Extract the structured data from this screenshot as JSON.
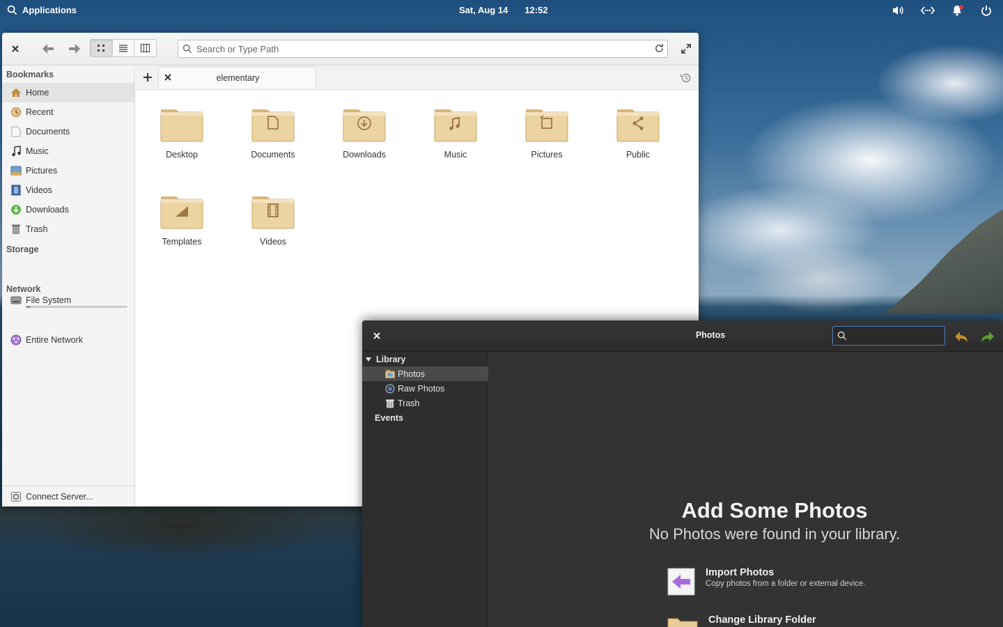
{
  "panel": {
    "applications_label": "Applications",
    "date": "Sat, Aug 14",
    "time": "12:52"
  },
  "files": {
    "path_placeholder": "Search or Type Path",
    "tab_label": "elementary",
    "sidebar": {
      "bookmarks_heading": "Bookmarks",
      "bookmarks": [
        {
          "label": "Home",
          "icon": "home-icon"
        },
        {
          "label": "Recent",
          "icon": "recent-icon"
        },
        {
          "label": "Documents",
          "icon": "document-icon"
        },
        {
          "label": "Music",
          "icon": "music-icon"
        },
        {
          "label": "Pictures",
          "icon": "pictures-icon"
        },
        {
          "label": "Videos",
          "icon": "videos-icon"
        },
        {
          "label": "Downloads",
          "icon": "downloads-icon"
        },
        {
          "label": "Trash",
          "icon": "trash-icon"
        }
      ],
      "storage_heading": "Storage",
      "storage_item": "File System",
      "storage_usage_fraction": 0.05,
      "network_heading": "Network",
      "network_item": "Entire Network",
      "connect_label": "Connect Server..."
    },
    "folders": [
      {
        "label": "Desktop",
        "glyph": "none"
      },
      {
        "label": "Documents",
        "glyph": "document"
      },
      {
        "label": "Downloads",
        "glyph": "download"
      },
      {
        "label": "Music",
        "glyph": "music"
      },
      {
        "label": "Pictures",
        "glyph": "picture"
      },
      {
        "label": "Public",
        "glyph": "share"
      },
      {
        "label": "Templates",
        "glyph": "template"
      },
      {
        "label": "Videos",
        "glyph": "video"
      }
    ]
  },
  "photos": {
    "title": "Photos",
    "search_value": "",
    "sidebar": {
      "library_heading": "Library",
      "items": [
        "Photos",
        "Raw Photos",
        "Trash"
      ],
      "events_heading": "Events"
    },
    "welcome_title": "Add Some Photos",
    "welcome_subtitle": "No Photos were found in your library.",
    "actions": [
      {
        "title": "Import Photos",
        "description": "Copy photos from a folder or external device."
      },
      {
        "title": "Change Library Folder",
        "description": ""
      }
    ]
  },
  "colors": {
    "folder_tan": "#e8cc98",
    "photos_bg": "#333333",
    "accent_blue": "#4a7fbf",
    "nav_arrow_orange": "#c48a2c",
    "nav_arrow_green": "#5f9b36"
  }
}
